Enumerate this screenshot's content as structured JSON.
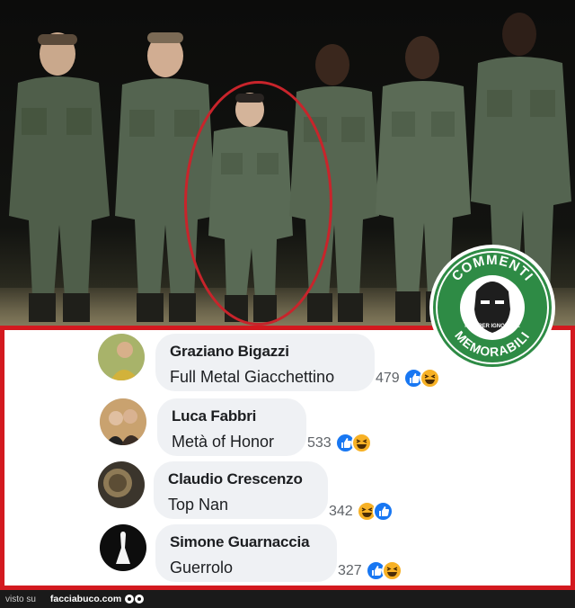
{
  "photo": {
    "badge": {
      "top_text": "COMMENTI",
      "bottom_text": "MEMORABILI",
      "small_text": "NATI PER IGNORARE",
      "color": "#2e8b45"
    },
    "highlight_color": "#c8242b"
  },
  "comments": [
    {
      "name": "Graziano Bigazzi",
      "text": "Full Metal Giacchettino",
      "count": "479",
      "reactions": [
        "like-icon",
        "haha-icon"
      ]
    },
    {
      "name": "Luca Fabbri",
      "text": "Metà of Honor",
      "count": "533",
      "reactions": [
        "like-icon",
        "haha-icon"
      ]
    },
    {
      "name": "Claudio Crescenzo",
      "text": "Top Nan",
      "count": "342",
      "reactions": [
        "haha-icon",
        "like-icon"
      ]
    },
    {
      "name": "Simone Guarnaccia",
      "text": "Guerrolo",
      "count": "327",
      "reactions": [
        "like-icon",
        "haha-icon"
      ]
    }
  ],
  "footer": {
    "visto": "visto su",
    "site": "facciabuco.com"
  },
  "colors": {
    "frame_red": "#d3191f",
    "like_blue": "#1877f2",
    "haha_yellow": "#f7b125"
  }
}
